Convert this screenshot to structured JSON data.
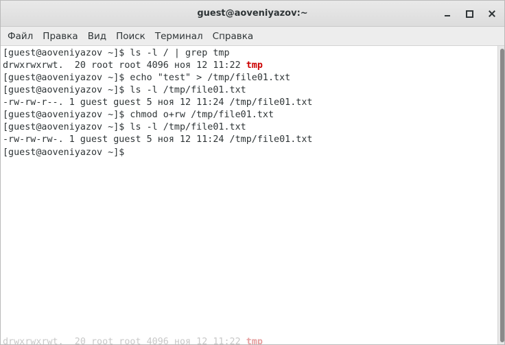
{
  "window": {
    "title": "guest@aoveniyazov:~"
  },
  "menubar": {
    "items": [
      "Файл",
      "Правка",
      "Вид",
      "Поиск",
      "Терминал",
      "Справка"
    ]
  },
  "terminal": {
    "lines": [
      {
        "text": "[guest@aoveniyazov ~]$ ls -l / | grep tmp"
      },
      {
        "text": "drwxrwxrwt.  20 root root 4096 ноя 12 11:22 ",
        "highlight": "tmp"
      },
      {
        "text": "[guest@aoveniyazov ~]$ echo \"test\" > /tmp/file01.txt"
      },
      {
        "text": "[guest@aoveniyazov ~]$ ls -l /tmp/file01.txt"
      },
      {
        "text": "-rw-rw-r--. 1 guest guest 5 ноя 12 11:24 /tmp/file01.txt"
      },
      {
        "text": "[guest@aoveniyazov ~]$ chmod o+rw /tmp/file01.txt"
      },
      {
        "text": "[guest@aoveniyazov ~]$ ls -l /tmp/file01.txt"
      },
      {
        "text": "-rw-rw-rw-. 1 guest guest 5 ноя 12 11:24 /tmp/file01.txt"
      },
      {
        "text": "[guest@aoveniyazov ~]$"
      }
    ],
    "ghost_line": {
      "text": "drwxrwxrwt.  20 root root 4096 ноя 12 11:22 ",
      "highlight": "tmp"
    }
  },
  "colors": {
    "highlight": "#cc0000",
    "text": "#2e3436"
  }
}
